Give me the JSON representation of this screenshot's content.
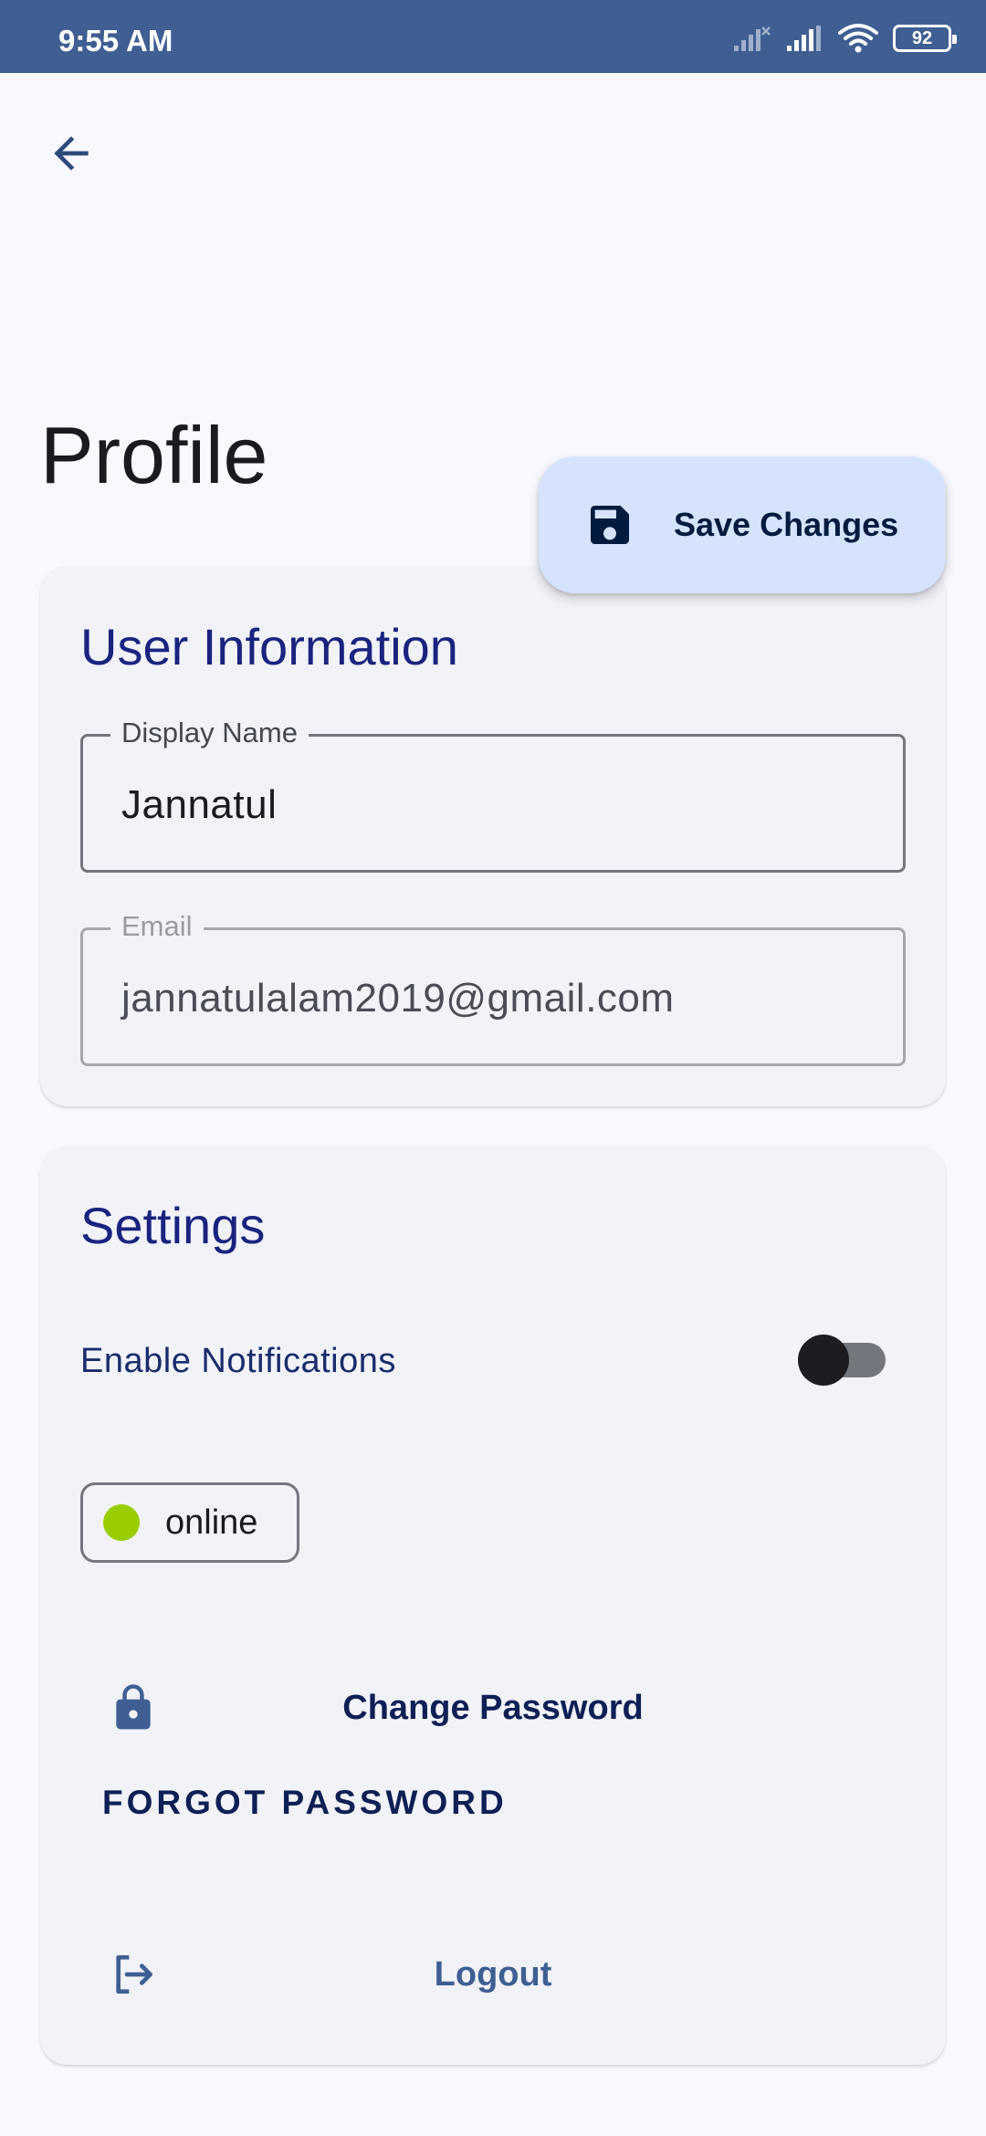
{
  "status_bar": {
    "time": "9:55 AM",
    "battery": "92",
    "icons": [
      "signal-off-icon",
      "signal-icon",
      "wifi-icon",
      "battery-icon"
    ]
  },
  "header": {
    "back_icon": "arrow-left-icon",
    "title": "Profile"
  },
  "save_button": {
    "label": "Save Changes",
    "icon": "save-icon"
  },
  "user_information": {
    "title": "User Information",
    "display_name": {
      "label": "Display Name",
      "value": "Jannatul"
    },
    "email": {
      "label": "Email",
      "value": "jannatulalam2019@gmail.com"
    }
  },
  "settings": {
    "title": "Settings",
    "notifications_label": "Enable Notifications",
    "notifications_enabled": false,
    "status_chip": {
      "label": "online",
      "dot_color": "#9acd00"
    },
    "change_password": {
      "label": "Change Password",
      "icon": "lock-icon"
    },
    "forgot_password": "FORGOT PASSWORD",
    "logout": {
      "label": "Logout",
      "icon": "logout-icon"
    }
  },
  "colors": {
    "status_bar": "#3f5f93",
    "background": "#f8f9ff",
    "card": "#f1f3f9",
    "fab": "#d6e3ff",
    "heading": "#1a237e",
    "primary_dark": "#0e1f55",
    "logout_text": "#3f5f93"
  }
}
